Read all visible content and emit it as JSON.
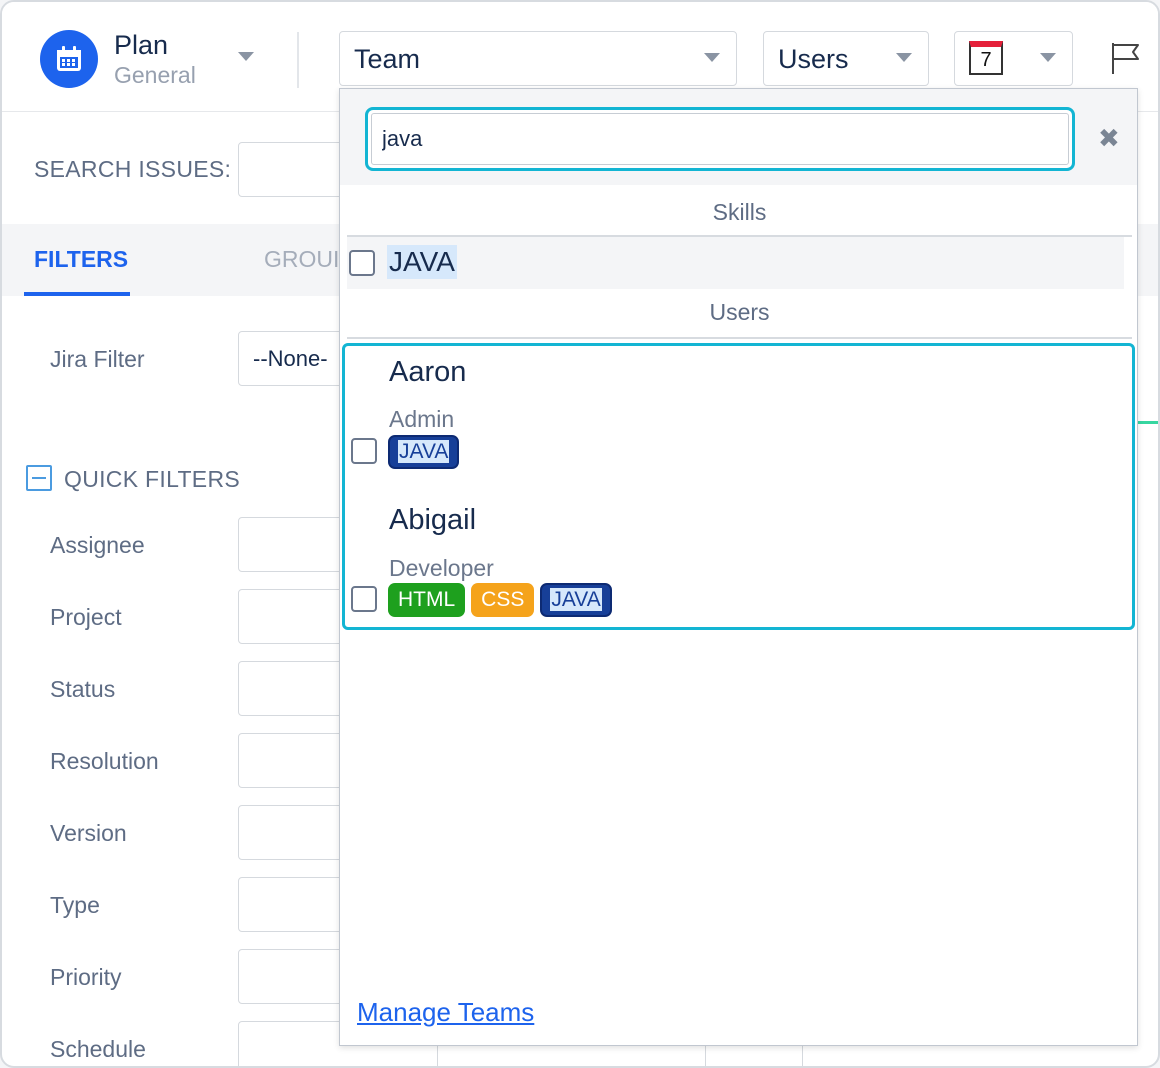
{
  "header": {
    "plan_title": "Plan",
    "plan_subtitle": "General",
    "team_select": "Team",
    "users_select": "Users",
    "calendar_day": "7",
    "accent": "#1d63ed"
  },
  "left_panel": {
    "search_label": "SEARCH ISSUES:",
    "tabs": {
      "filters": "FILTERS",
      "group": "GROUI"
    },
    "jira_filter_label": "Jira Filter",
    "jira_filter_value": "--None-",
    "quick_filters_label": "QUICK FILTERS",
    "quick_filters": [
      {
        "label": "Assignee"
      },
      {
        "label": "Project"
      },
      {
        "label": "Status"
      },
      {
        "label": "Resolution"
      },
      {
        "label": "Version"
      },
      {
        "label": "Type"
      },
      {
        "label": "Priority"
      },
      {
        "label": "Schedule"
      }
    ]
  },
  "dropdown": {
    "search_value": "java",
    "skills_header": "Skills",
    "skill_item": "JAVA",
    "users_header": "Users",
    "users": [
      {
        "name": "Aaron",
        "role": "Admin",
        "tags": [
          "JAVA"
        ]
      },
      {
        "name": "Abigail",
        "role": "Developer",
        "tags": [
          "HTML",
          "CSS",
          "JAVA"
        ]
      }
    ],
    "manage_link": "Manage Teams",
    "highlight_color": "#13b5d3"
  }
}
